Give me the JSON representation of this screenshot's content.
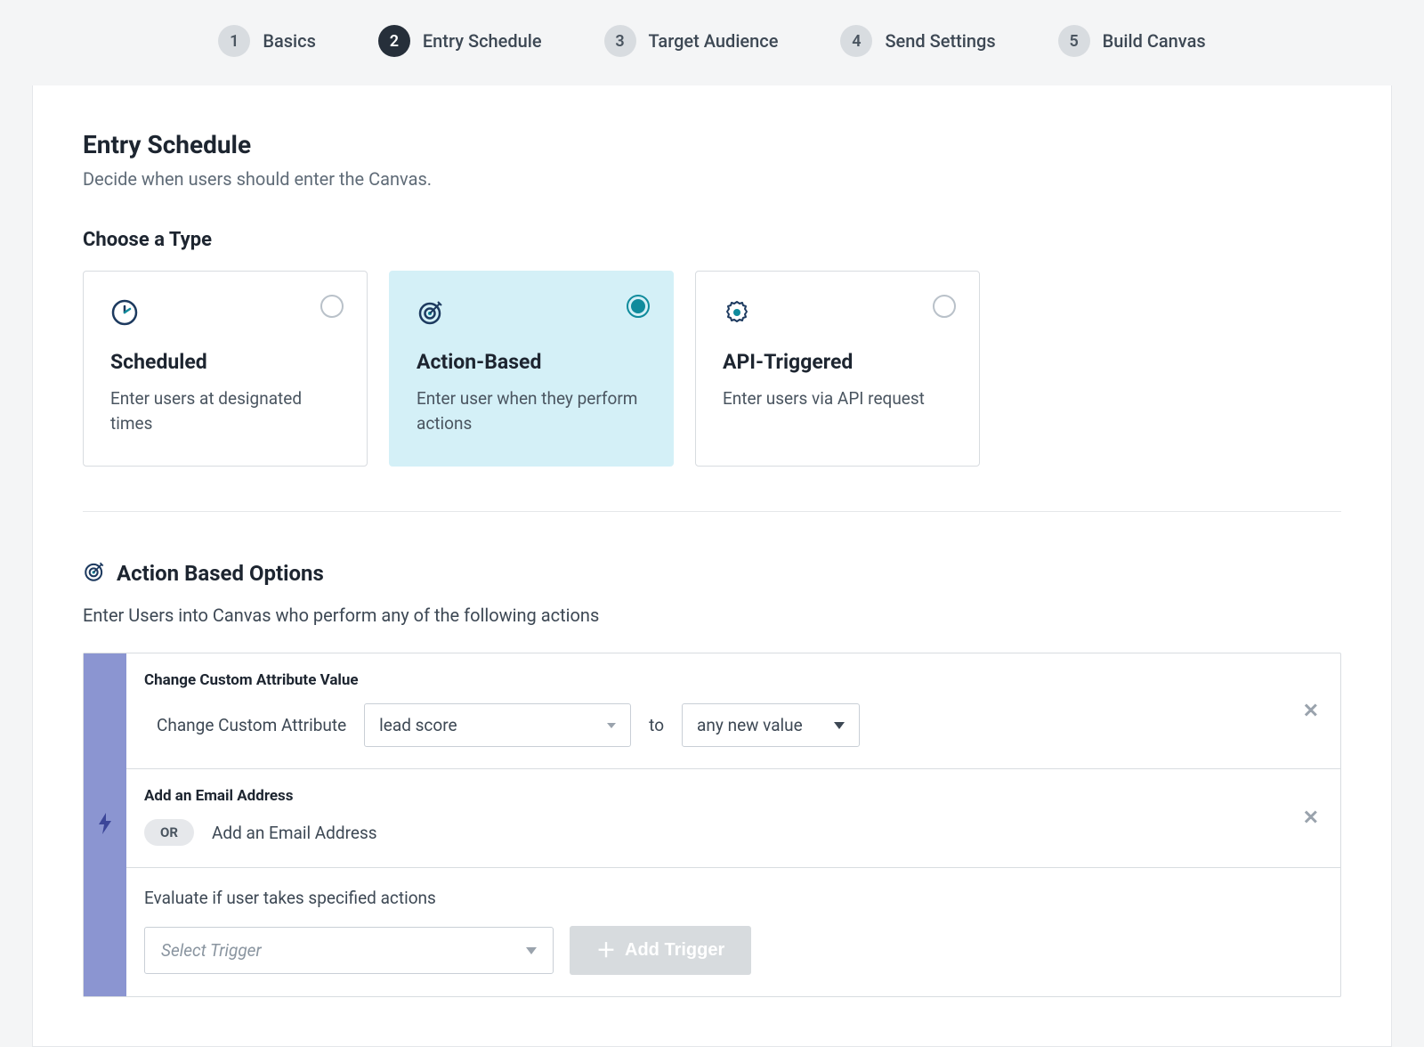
{
  "stepper": {
    "steps": [
      {
        "num": "1",
        "label": "Basics",
        "active": false
      },
      {
        "num": "2",
        "label": "Entry Schedule",
        "active": true
      },
      {
        "num": "3",
        "label": "Target Audience",
        "active": false
      },
      {
        "num": "4",
        "label": "Send Settings",
        "active": false
      },
      {
        "num": "5",
        "label": "Build Canvas",
        "active": false
      }
    ]
  },
  "header": {
    "title": "Entry Schedule",
    "subtitle": "Decide when users should enter the Canvas."
  },
  "typeSection": {
    "title": "Choose a Type",
    "cards": [
      {
        "icon": "clock-icon",
        "title": "Scheduled",
        "desc": "Enter users at designated times",
        "selected": false
      },
      {
        "icon": "target-icon",
        "title": "Action-Based",
        "desc": "Enter user when they perform actions",
        "selected": true
      },
      {
        "icon": "gear-icon",
        "title": "API-Triggered",
        "desc": "Enter users via API request",
        "selected": false
      }
    ]
  },
  "options": {
    "title": "Action Based Options",
    "subtext": "Enter Users into Canvas who perform any of the following actions",
    "triggers": [
      {
        "title": "Change Custom Attribute Value",
        "prefix": "Change Custom Attribute",
        "attribute": "lead score",
        "conj": "to",
        "value": "any new value",
        "or": false
      },
      {
        "title": "Add an Email Address",
        "or": true,
        "or_label": "OR",
        "text": "Add an Email Address"
      }
    ],
    "evalText": "Evaluate if user takes specified actions",
    "selectTriggerPlaceholder": "Select Trigger",
    "addTriggerLabel": "Add Trigger"
  }
}
